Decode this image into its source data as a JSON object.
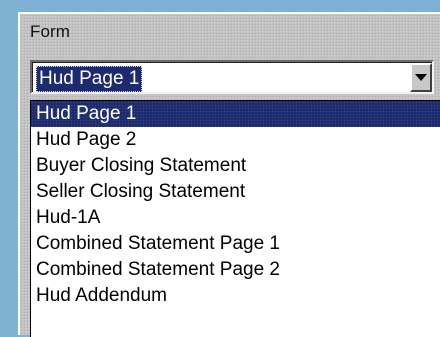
{
  "form": {
    "label": "Form",
    "selected_value": "Hud Page 1",
    "dropdown_icon": "chevron-down-icon",
    "options": [
      "Hud Page 1",
      "Hud Page 2",
      "Buyer Closing Statement",
      "Seller Closing Statement",
      "Hud-1A",
      "Combined Statement Page 1",
      "Combined Statement Page 2",
      "Hud Addendum"
    ],
    "highlighted_index": 0
  },
  "colors": {
    "selection": "#1c2a6e",
    "panel": "#c4c4c4",
    "page_background": "#7fb2d2"
  }
}
